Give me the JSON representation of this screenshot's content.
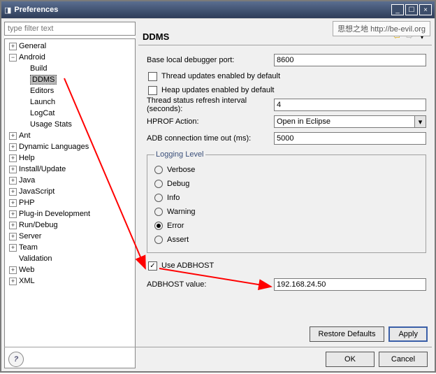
{
  "window": {
    "title": "Preferences"
  },
  "watermark": "思想之地 http://be-evil.org",
  "filter_placeholder": "type filter text",
  "tree": {
    "general": "General",
    "android": "Android",
    "android_children": {
      "build": "Build",
      "ddms": "DDMS",
      "editors": "Editors",
      "launch": "Launch",
      "logcat": "LogCat",
      "usage": "Usage Stats"
    },
    "ant": "Ant",
    "dynlang": "Dynamic Languages",
    "help": "Help",
    "install": "Install/Update",
    "java": "Java",
    "javascript": "JavaScript",
    "php": "PHP",
    "plugin": "Plug-in Development",
    "rundebug": "Run/Debug",
    "server": "Server",
    "team": "Team",
    "validation": "Validation",
    "web": "Web",
    "xml": "XML"
  },
  "page": {
    "title": "DDMS"
  },
  "form": {
    "labels": {
      "baseport": "Base local debugger port:",
      "thread_upd": "Thread updates enabled by default",
      "heap_upd": "Heap updates enabled by default",
      "thread_int": "Thread status refresh interval (seconds):",
      "hprof": "HPROF Action:",
      "adb_timeout": "ADB connection time out (ms):",
      "use_adbhost": "Use ADBHOST",
      "adbhost_val": "ADBHOST value:"
    },
    "values": {
      "baseport": "8600",
      "thread_int": "4",
      "hprof": "Open in Eclipse",
      "adb_timeout": "5000",
      "adbhost_val": "192.168.24.50"
    },
    "checked": {
      "thread_upd": false,
      "heap_upd": false,
      "use_adbhost": true
    },
    "logging": {
      "legend": "Logging Level",
      "options": {
        "verbose": "Verbose",
        "debug": "Debug",
        "info": "Info",
        "warning": "Warning",
        "error": "Error",
        "assert": "Assert"
      },
      "selected": "error"
    }
  },
  "buttons": {
    "restore": "Restore Defaults",
    "apply": "Apply",
    "ok": "OK",
    "cancel": "Cancel"
  }
}
